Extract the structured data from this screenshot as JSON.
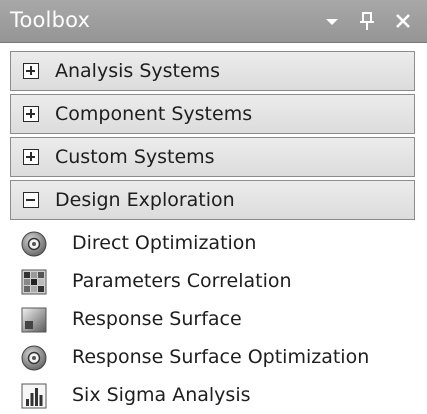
{
  "window": {
    "title": "Toolbox",
    "dropdown_icon": "dropdown-arrow-icon",
    "pin_icon": "pin-icon",
    "close_icon": "close-icon"
  },
  "groups": [
    {
      "label": "Analysis Systems",
      "expanded": false
    },
    {
      "label": "Component Systems",
      "expanded": false
    },
    {
      "label": "Custom Systems",
      "expanded": false
    },
    {
      "label": "Design Exploration",
      "expanded": true
    }
  ],
  "items": [
    {
      "label": "Direct Optimization",
      "icon": "direct-optimization-icon"
    },
    {
      "label": "Parameters Correlation",
      "icon": "parameters-correlation-icon"
    },
    {
      "label": "Response Surface",
      "icon": "response-surface-icon"
    },
    {
      "label": "Response Surface Optimization",
      "icon": "response-surface-optimization-icon"
    },
    {
      "label": "Six Sigma Analysis",
      "icon": "six-sigma-analysis-icon"
    }
  ]
}
